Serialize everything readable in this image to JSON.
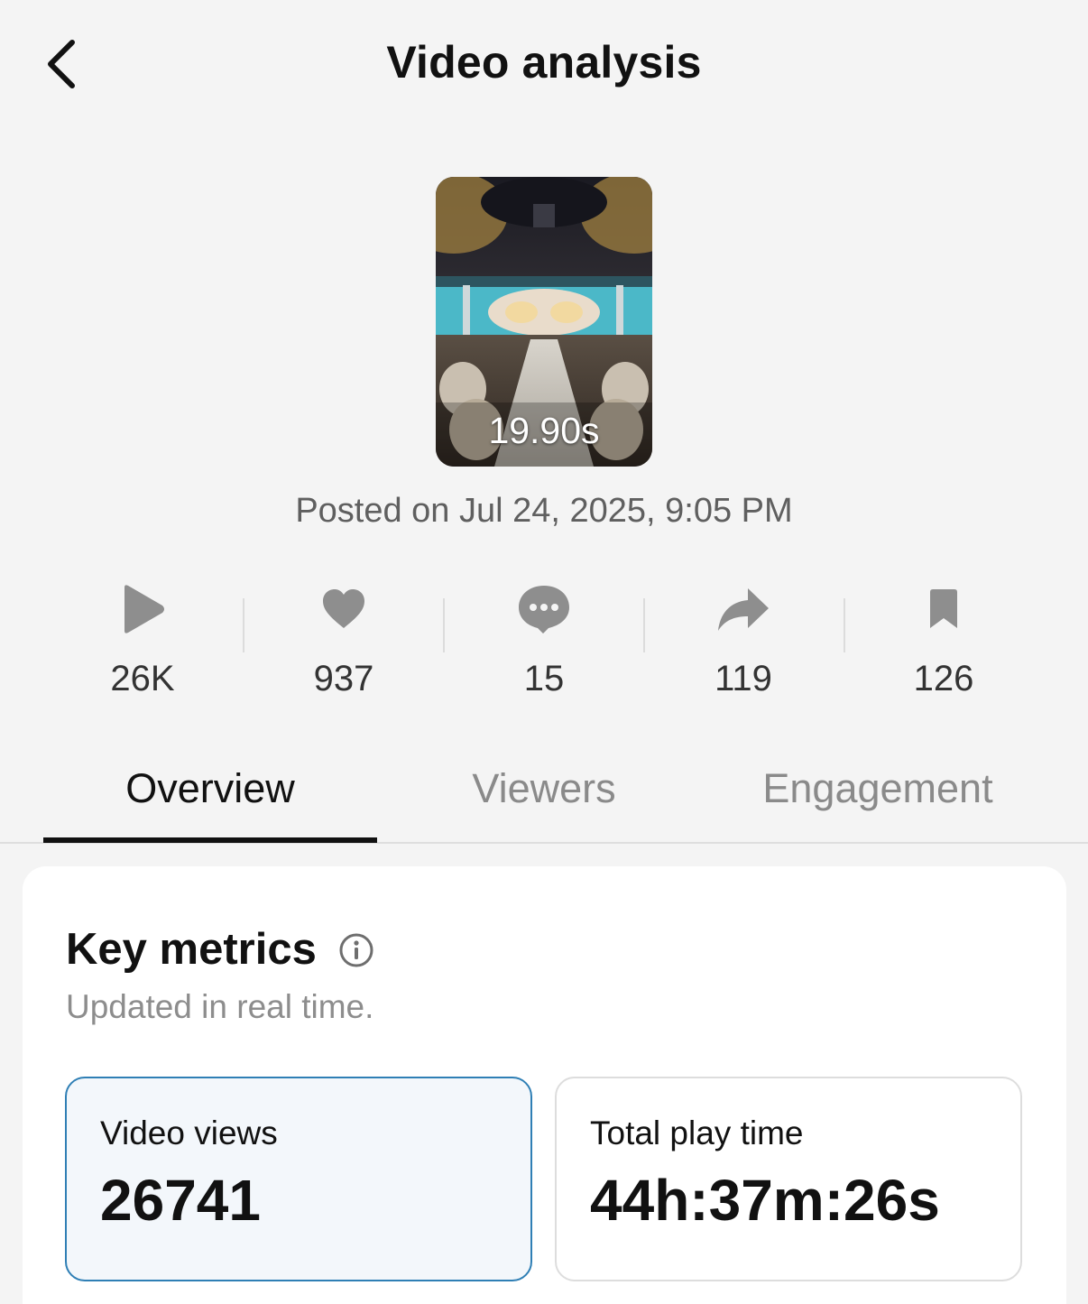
{
  "header": {
    "title": "Video analysis",
    "back_icon": "chevron-left-icon"
  },
  "video": {
    "duration": "19.90s",
    "posted": "Posted on Jul 24, 2025, 9:05 PM"
  },
  "stats": [
    {
      "icon": "play-icon",
      "value": "26K"
    },
    {
      "icon": "heart-icon",
      "value": "937"
    },
    {
      "icon": "comment-icon",
      "value": "15"
    },
    {
      "icon": "share-icon",
      "value": "119"
    },
    {
      "icon": "bookmark-icon",
      "value": "126"
    }
  ],
  "tabs": [
    {
      "label": "Overview",
      "active": true
    },
    {
      "label": "Viewers",
      "active": false
    },
    {
      "label": "Engagement",
      "active": false
    }
  ],
  "key_metrics": {
    "title": "Key metrics",
    "subtitle": "Updated in real time.",
    "cards": [
      {
        "label": "Video views",
        "value": "26741",
        "selected": true
      },
      {
        "label": "Total play time",
        "value": "44h:37m:26s",
        "selected": false
      }
    ]
  },
  "colors": {
    "background": "#f4f4f4",
    "icon_gray": "#8e8e8e",
    "selected_border": "#2f7fb5",
    "selected_fill": "#f3f7fb"
  }
}
